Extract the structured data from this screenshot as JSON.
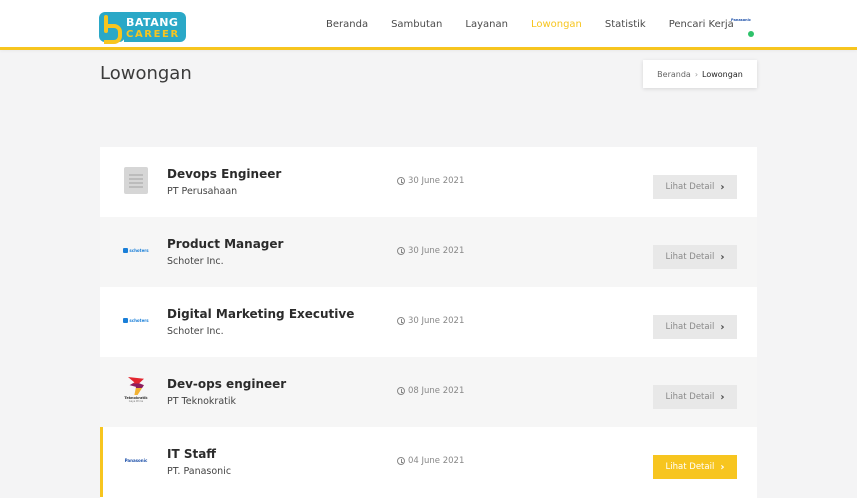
{
  "brand": {
    "line1": "BATANG",
    "line2": "CAREER"
  },
  "nav": {
    "items": [
      {
        "label": "Beranda",
        "active": false
      },
      {
        "label": "Sambutan",
        "active": false
      },
      {
        "label": "Layanan",
        "active": false
      },
      {
        "label": "Lowongan",
        "active": true
      },
      {
        "label": "Statistik",
        "active": false
      },
      {
        "label": "Pencari Kerja",
        "active": false
      }
    ]
  },
  "user": {
    "company_logo_text": "Panasonic",
    "status": "online"
  },
  "page": {
    "title": "Lowongan",
    "breadcrumb": {
      "home": "Beranda",
      "separator": "›",
      "current": "Lowongan"
    }
  },
  "jobs": [
    {
      "title": "Devops Engineer",
      "company": "PT Perusahaan",
      "date": "30 June 2021",
      "button": "Lihat Detail",
      "logo": "building-icon",
      "logo_text": ""
    },
    {
      "title": "Product Manager",
      "company": "Schoter Inc.",
      "date": "30 June 2021",
      "button": "Lihat Detail",
      "logo": "schoters-logo",
      "logo_text": "schoters"
    },
    {
      "title": "Digital Marketing Executive",
      "company": "Schoter Inc.",
      "date": "30 June 2021",
      "button": "Lihat Detail",
      "logo": "schoters-logo",
      "logo_text": "schoters"
    },
    {
      "title": "Dev-ops engineer",
      "company": "PT Teknokratik",
      "date": "08 June 2021",
      "button": "Lihat Detail",
      "logo": "teknokratik-logo",
      "logo_text": "Teknokratik",
      "logo_subtext": "Gaya Prima"
    },
    {
      "title": "IT Staff",
      "company": "PT. Panasonic",
      "date": "04 June 2021",
      "button": "Lihat Detail",
      "logo": "panasonic-logo",
      "logo_text": "Panasonic"
    }
  ],
  "colors": {
    "accent": "#f7c51f",
    "brand": "#2aa8c7",
    "button_inactive": "#e8e8e8",
    "online": "#2ec26a"
  }
}
